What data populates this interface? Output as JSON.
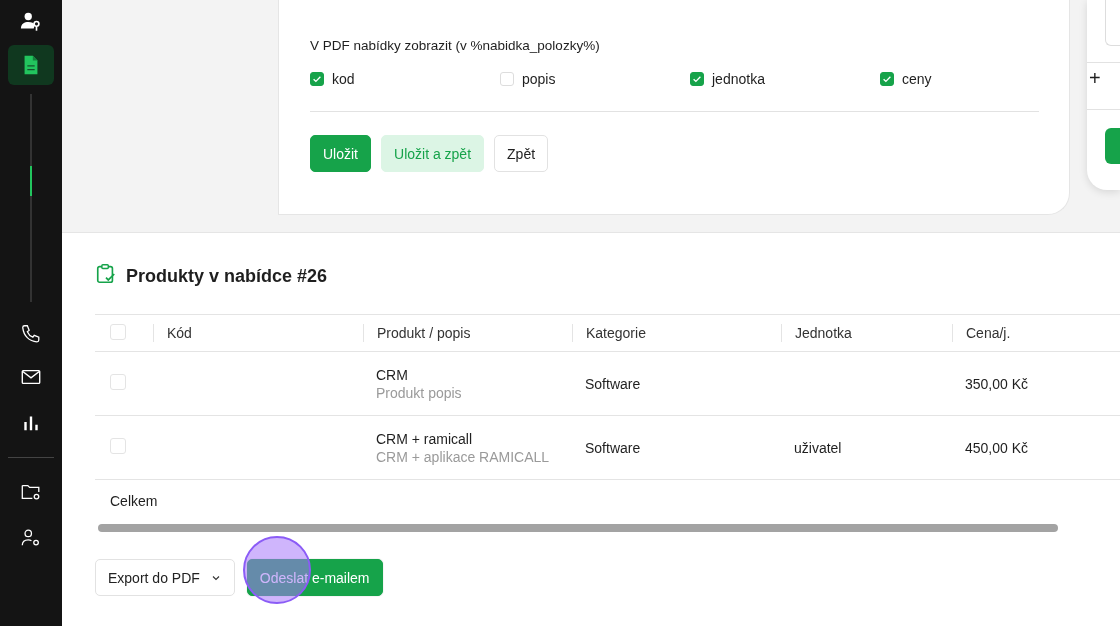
{
  "sidebar": {
    "items": [
      {
        "kind": "user-key",
        "selected": false
      },
      {
        "kind": "document",
        "selected": true
      },
      {
        "kind": "track"
      },
      {
        "kind": "phone",
        "selected": false
      },
      {
        "kind": "mail",
        "selected": false
      },
      {
        "kind": "chart",
        "selected": false
      },
      {
        "kind": "divider"
      },
      {
        "kind": "folder-gear",
        "selected": false
      },
      {
        "kind": "user-gear",
        "selected": false
      }
    ]
  },
  "pdf_options": {
    "label": "V PDF nabídky zobrazit (v %nabidka_polozky%)",
    "options": [
      {
        "label": "kod",
        "checked": true
      },
      {
        "label": "popis",
        "checked": false
      },
      {
        "label": "jednotka",
        "checked": true
      },
      {
        "label": "ceny",
        "checked": true
      }
    ]
  },
  "form_buttons": [
    {
      "label": "Uložit",
      "kind": "primary"
    },
    {
      "label": "Uložit a zpět",
      "kind": "soft"
    },
    {
      "label": "Zpět",
      "kind": "outline"
    }
  ],
  "side_panel": {
    "add": "+"
  },
  "products": {
    "title": "Produkty v nabídce #26",
    "header_checked": false,
    "columns": [
      "Kód",
      "Produkt / popis",
      "Kategorie",
      "Jednotka",
      "Cena/j."
    ],
    "rows": [
      {
        "checked": false,
        "product": "CRM",
        "description": "Produkt popis",
        "category": "Software",
        "price": "350,00 Kč"
      },
      {
        "checked": false,
        "product": "CRM + ramicall",
        "description": "CRM + aplikace RAMICALL",
        "category": "Software",
        "unit": "uživatel",
        "price": "450,00 Kč"
      }
    ],
    "total_label": "Celkem"
  },
  "actions": [
    {
      "label": "Export do PDF",
      "kind": "dropdown",
      "clicked": false
    },
    {
      "label": "Odeslat e-mailem",
      "kind": "primary",
      "clicked": true
    }
  ]
}
